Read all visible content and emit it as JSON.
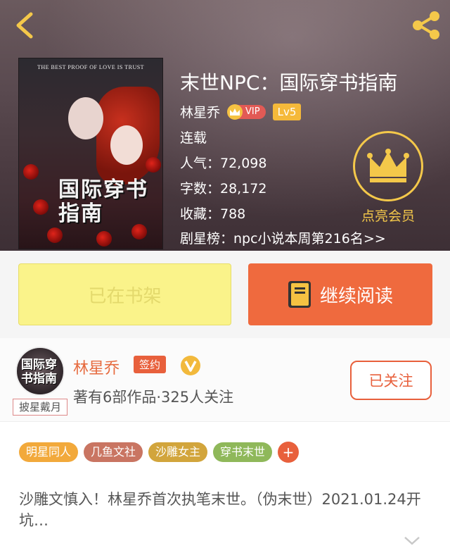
{
  "header": {
    "back_icon": "chevron-left-icon",
    "share_icon": "share-icon",
    "accent_color": "#f4c84a"
  },
  "book": {
    "cover": {
      "tagline": "THE BEST PROOF OF LOVE IS TRUST",
      "title": "国际穿书指南"
    },
    "title": "末世NPC：国际穿书指南",
    "author": "林星乔",
    "vip_label": "VIP",
    "level": "Lv5",
    "status": "连载",
    "popularity": "人气：72,098",
    "word_count": "字数：28,172",
    "favorites": "收藏：788",
    "ranking": "剧星榜：npc小说本周第216名>>"
  },
  "member": {
    "label": "点亮会员",
    "icon": "crown-icon"
  },
  "actions": {
    "shelf_label": "已在书架",
    "read_label": "继续阅读",
    "read_icon": "book-icon"
  },
  "author_card": {
    "avatar_text": "国际穿书指南",
    "avatar_caption": "披星戴月",
    "name": "林星乔",
    "signed_label": "签约",
    "stats": "著有6部作品·325人关注",
    "follow_label": "已关注"
  },
  "tags": [
    {
      "label": "明星同人",
      "color": "#f2a93b"
    },
    {
      "label": "几鱼文社",
      "color": "#c97562"
    },
    {
      "label": "沙雕女主",
      "color": "#d2a53c"
    },
    {
      "label": "穿书末世",
      "color": "#8fb85a"
    }
  ],
  "tag_more": "+",
  "description": "沙雕文慎入！林星乔首次执笔末世。（伪末世）2021.01.24开坑…"
}
